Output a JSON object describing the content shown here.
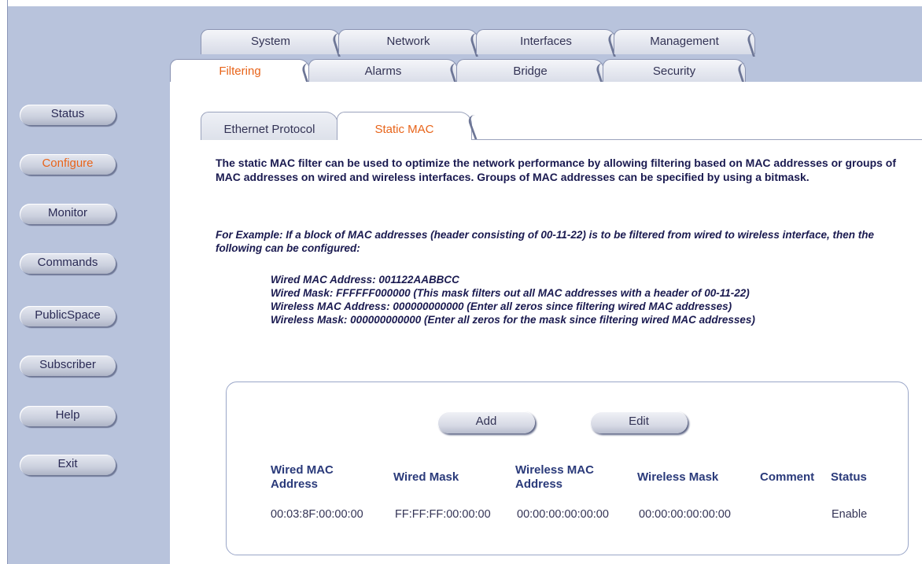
{
  "sidebar": {
    "items": [
      {
        "label": "Status",
        "active": false
      },
      {
        "label": "Configure",
        "active": true
      },
      {
        "label": "Monitor",
        "active": false
      },
      {
        "label": "Commands",
        "active": false
      },
      {
        "label": "PublicSpace",
        "active": false
      },
      {
        "label": "Subscriber",
        "active": false
      },
      {
        "label": "Help",
        "active": false
      },
      {
        "label": "Exit",
        "active": false
      }
    ]
  },
  "main_tabs": [
    "System",
    "Network",
    "Interfaces",
    "Management"
  ],
  "sub_tabs": [
    "Filtering",
    "Alarms",
    "Bridge",
    "Security"
  ],
  "active_sub_tab": "Filtering",
  "filter_tabs": [
    "Ethernet Protocol",
    "Static MAC"
  ],
  "active_filter_tab": "Static MAC",
  "description": "The static MAC filter can be used to optimize the network performance by allowing filtering based on MAC addresses or groups of MAC addresses on wired and wireless interfaces. Groups of MAC addresses can be specified by using a bitmask.",
  "example_intro": "For Example: If a block of MAC addresses (header consisting of 00-11-22) is to be filtered from wired to wireless interface, then the following can be configured:",
  "example_lines": [
    "Wired MAC Address: 001122AABBCC",
    "Wired Mask: FFFFFF000000 (This mask filters out all MAC addresses with a header of 00-11-22)",
    "Wireless MAC Address: 000000000000 (Enter all zeros since filtering wired MAC addresses)",
    "Wireless Mask: 000000000000 (Enter all zeros for the mask since filtering wired MAC addresses)"
  ],
  "buttons": {
    "add": "Add",
    "edit": "Edit"
  },
  "table": {
    "headers": [
      "Wired MAC Address",
      "Wired Mask",
      "Wireless MAC Address",
      "Wireless Mask",
      "Comment",
      "Status"
    ],
    "rows": [
      [
        "00:03:8F:00:00:00",
        "FF:FF:FF:00:00:00",
        "00:00:00:00:00:00",
        "00:00:00:00:00:00",
        "",
        "Enable"
      ]
    ]
  },
  "colors": {
    "accent": "#e8641a",
    "sidebar_bg": "#b8c3dc",
    "header_text": "#2a3a7a"
  }
}
